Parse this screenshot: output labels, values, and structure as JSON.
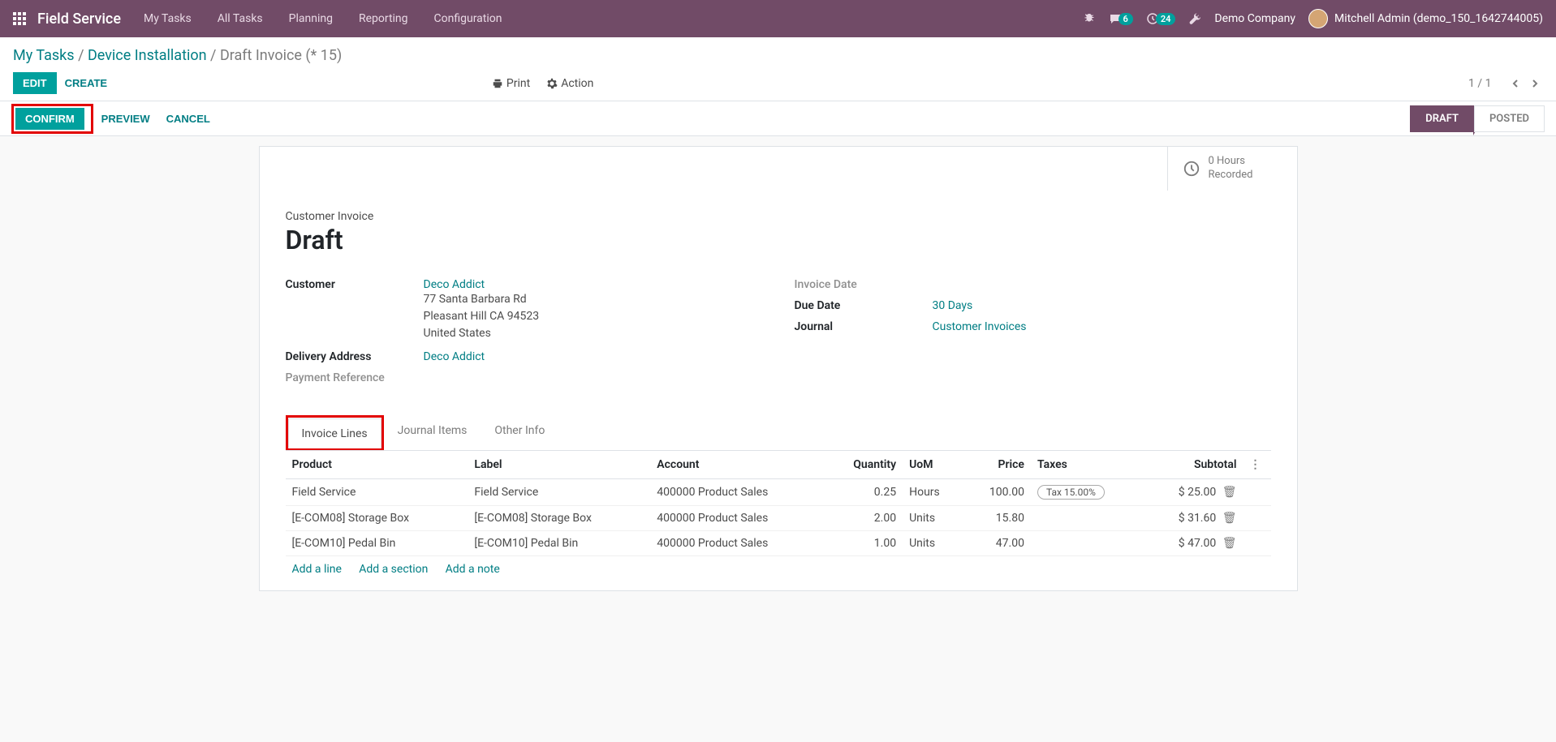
{
  "navbar": {
    "brand": "Field Service",
    "links": [
      "My Tasks",
      "All Tasks",
      "Planning",
      "Reporting",
      "Configuration"
    ],
    "msg_badge": "6",
    "activity_badge": "24",
    "company": "Demo Company",
    "user": "Mitchell Admin (demo_150_1642744005)"
  },
  "breadcrumb": {
    "a": "My Tasks",
    "b": "Device Installation",
    "c": "Draft Invoice (* 15)"
  },
  "buttons": {
    "edit": "EDIT",
    "create": "CREATE",
    "print": "Print",
    "action": "Action",
    "confirm": "CONFIRM",
    "preview": "PREVIEW",
    "cancel": "CANCEL"
  },
  "pager": "1 / 1",
  "status": {
    "draft": "DRAFT",
    "posted": "POSTED"
  },
  "stat": {
    "line1": "0 Hours",
    "line2": "Recorded"
  },
  "form": {
    "section_label": "Customer Invoice",
    "title": "Draft",
    "customer_label": "Customer",
    "customer_link": "Deco Addict",
    "addr1": "77 Santa Barbara Rd",
    "addr2": "Pleasant Hill CA 94523",
    "addr3": "United States",
    "delivery_label": "Delivery Address",
    "delivery_link": "Deco Addict",
    "payref_label": "Payment Reference",
    "invoice_date_label": "Invoice Date",
    "due_date_label": "Due Date",
    "due_date_value": "30 Days",
    "journal_label": "Journal",
    "journal_value": "Customer Invoices"
  },
  "tabs": {
    "a": "Invoice Lines",
    "b": "Journal Items",
    "c": "Other Info"
  },
  "table": {
    "headers": {
      "product": "Product",
      "label": "Label",
      "account": "Account",
      "qty": "Quantity",
      "uom": "UoM",
      "price": "Price",
      "taxes": "Taxes",
      "subtotal": "Subtotal"
    },
    "rows": [
      {
        "product": "Field Service",
        "label": "Field Service",
        "account": "400000 Product Sales",
        "qty": "0.25",
        "uom": "Hours",
        "price": "100.00",
        "tax": "Tax 15.00%",
        "subtotal": "$ 25.00"
      },
      {
        "product": "[E-COM08] Storage Box",
        "label": "[E-COM08] Storage Box",
        "account": "400000 Product Sales",
        "qty": "2.00",
        "uom": "Units",
        "price": "15.80",
        "tax": "",
        "subtotal": "$ 31.60"
      },
      {
        "product": "[E-COM10] Pedal Bin",
        "label": "[E-COM10] Pedal Bin",
        "account": "400000 Product Sales",
        "qty": "1.00",
        "uom": "Units",
        "price": "47.00",
        "tax": "",
        "subtotal": "$ 47.00"
      }
    ],
    "add_line": "Add a line",
    "add_section": "Add a section",
    "add_note": "Add a note"
  }
}
